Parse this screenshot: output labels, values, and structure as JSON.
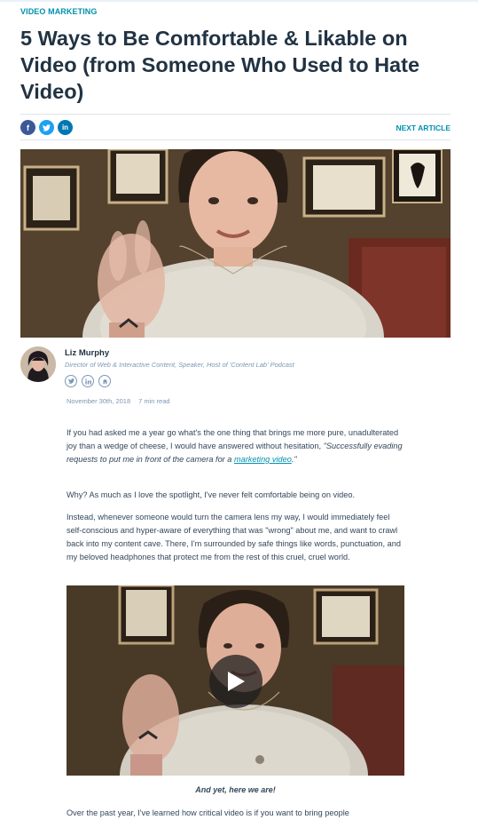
{
  "category": "VIDEO MARKETING",
  "title": "5 Ways to Be Comfortable & Likable on Video (from Someone Who Used to Hate Video)",
  "share": {
    "facebook_icon": "f",
    "twitter_icon": "t",
    "linkedin_icon": "in"
  },
  "next_article": "NEXT ARTICLE",
  "author": {
    "name": "Liz Murphy",
    "role": "Director of Web & Interactive Content, Speaker, Host of 'Content Lab' Podcast",
    "socials": [
      "twitter-icon",
      "linkedin-icon",
      "website-icon"
    ]
  },
  "meta": {
    "date": "November 30th, 2018",
    "read_time": "7 min read"
  },
  "paragraphs": {
    "p1_text": "If you had asked me a year go what's the one thing that brings me more pure, unadulterated joy than a wedge of cheese, I would have answered without hesitation, ",
    "p1_quote": "\"Successfully evading requests to put me in front of the camera for a ",
    "p1_link": "marketing video",
    "p1_end": ".\"",
    "p2": "Why? As much as I love the spotlight, I've never felt comfortable being on video.",
    "p3": "Instead, whenever someone would turn the camera lens my way, I would immediately feel self-conscious and hyper-aware of everything that was \"wrong\" about me, and want to crawl back into my content cave. There, I'm surrounded by safe things like words, punctuation, and my beloved headphones that protect me from the rest of this cruel, cruel world.",
    "caption": "And yet, here we are!",
    "p4": "Over the past year, I've learned how critical video is if you want to bring people"
  },
  "colors": {
    "accent": "#0091ae",
    "heading": "#213343",
    "body": "#33475b",
    "muted": "#7c98b6"
  }
}
